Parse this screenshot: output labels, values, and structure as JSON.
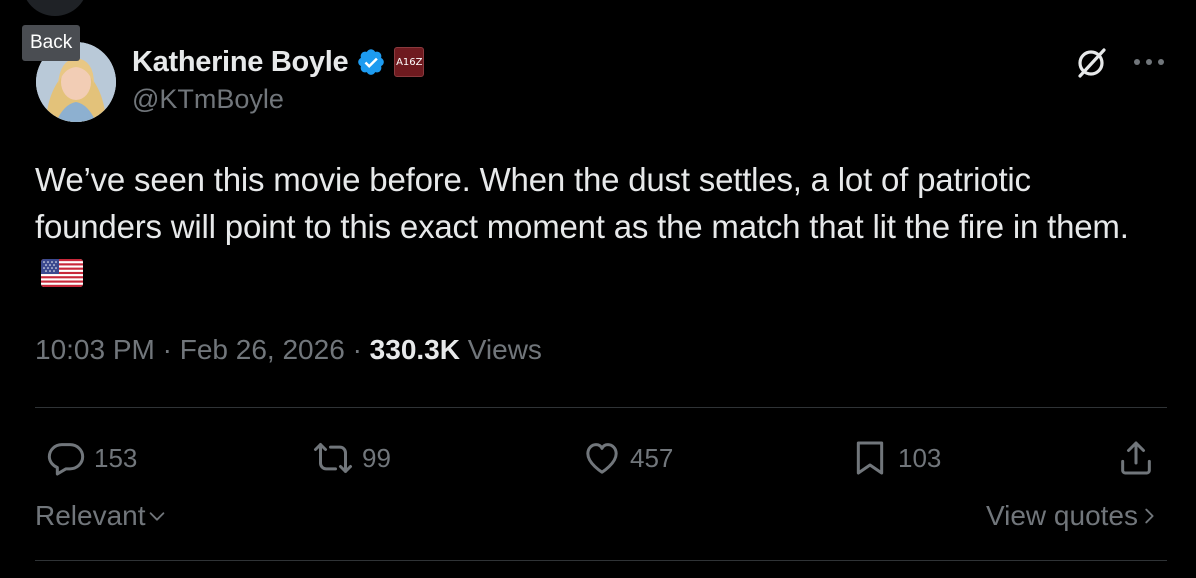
{
  "nav": {
    "back_label": "Back"
  },
  "author": {
    "display_name": "Katherine Boyle",
    "handle": "@KTmBoyle",
    "affiliate_badge": "A16Z",
    "verified": true
  },
  "tweet": {
    "text": "We’ve seen this movie before. When the dust settles, a lot of patriotic founders will point to this exact moment as the match that lit the fire in them.",
    "emoji": "us-flag",
    "time": "10:03 PM",
    "date": "Feb 26, 2026",
    "separator": "·",
    "views_count": "330.3K",
    "views_label": "Views"
  },
  "actions": {
    "replies": "153",
    "reposts": "99",
    "likes": "457",
    "bookmarks": "103"
  },
  "footer": {
    "sort_label": "Relevant",
    "view_quotes_label": "View quotes"
  },
  "colors": {
    "background": "#000000",
    "text_primary": "#e7e9ea",
    "text_secondary": "#71767b",
    "divider": "#2f3336",
    "verified_blue": "#1d9bf0"
  }
}
